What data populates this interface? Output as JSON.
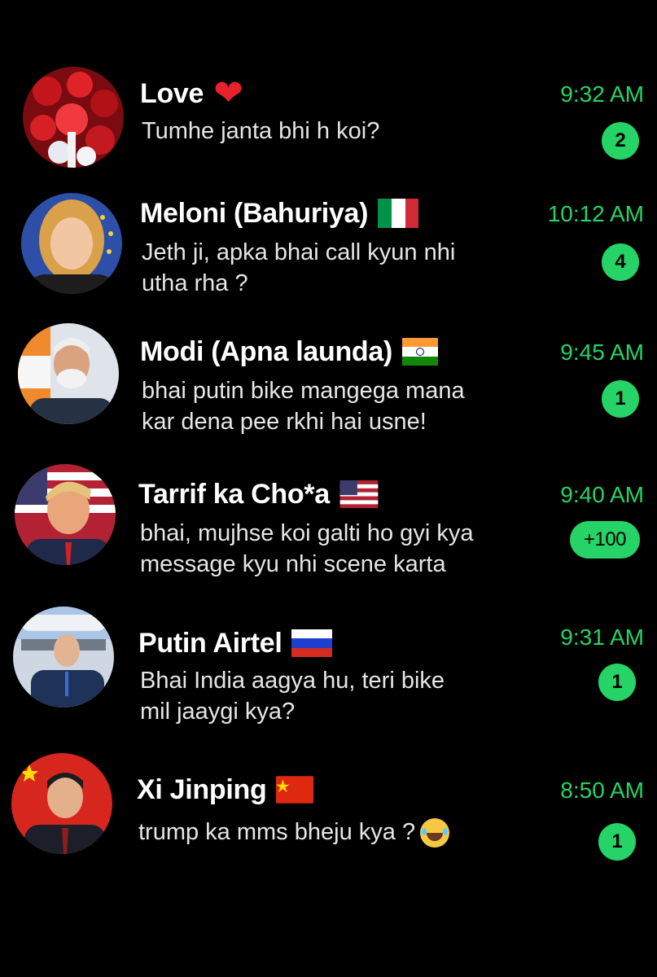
{
  "chats": [
    {
      "name": "Love",
      "emoji_icon": "red-heart-icon",
      "preview_lines": [
        "Tumhe janta bhi h koi?"
      ],
      "time": "9:32 AM",
      "unread": "2"
    },
    {
      "name": "Meloni (Bahuriya)",
      "emoji_icon": "flag-italy-icon",
      "preview_lines": [
        "Jeth ji, apka bhai call kyun nhi",
        "utha rha ?"
      ],
      "time": "10:12 AM",
      "unread": "4"
    },
    {
      "name": "Modi (Apna launda)",
      "emoji_icon": "flag-india-icon",
      "preview_lines": [
        "bhai putin bike mangega mana",
        "kar dena pee rkhi hai usne!"
      ],
      "time": "9:45 AM",
      "unread": "1"
    },
    {
      "name": "Tarrif ka Cho*a",
      "emoji_icon": "flag-usa-icon",
      "preview_lines": [
        "bhai, mujhse koi galti ho gyi kya",
        "message kyu nhi scene karta"
      ],
      "time": "9:40 AM",
      "unread": "+100"
    },
    {
      "name": "Putin Airtel",
      "emoji_icon": "flag-russia-icon",
      "preview_lines": [
        "Bhai India aagya hu, teri bike",
        "mil jaaygi kya?"
      ],
      "time": "9:31 AM",
      "unread": "1"
    },
    {
      "name": "Xi Jinping",
      "emoji_icon": "flag-china-icon",
      "preview_lines": [
        "trump ka mms bheju kya ?"
      ],
      "preview_emoji": "laughing-tears-emoji",
      "time": "8:50 AM",
      "unread": "1"
    }
  ],
  "colors": {
    "background": "#000000",
    "accent_green": "#25d366",
    "name_text": "#ffffff",
    "preview_text": "#e6e6e6"
  }
}
